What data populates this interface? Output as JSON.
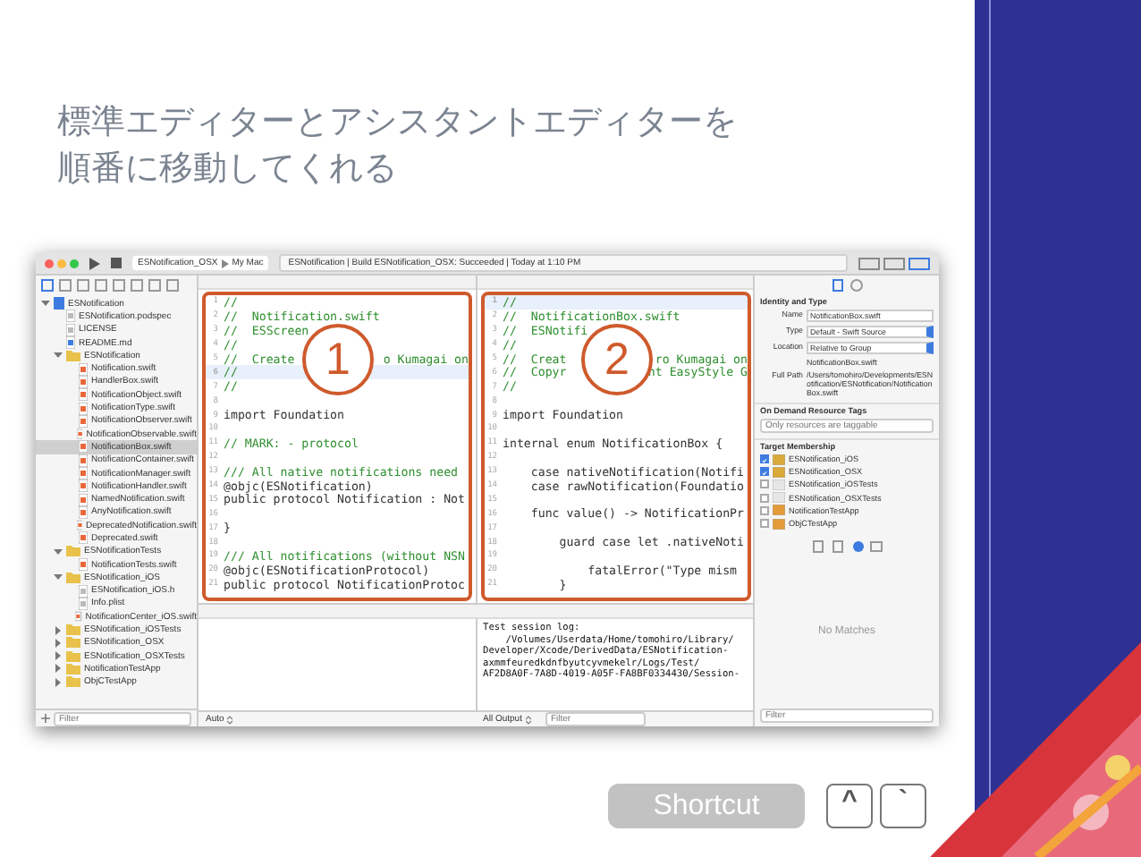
{
  "slide": {
    "title_lines": [
      "標準エディターとアシスタントエディターを",
      "順番に移動してくれる"
    ]
  },
  "xcode": {
    "toolbar": {
      "scheme": "ESNotification_OSX",
      "device": "My Mac",
      "status": "ESNotification  |  Build ESNotification_OSX: Succeeded  |  Today at 1:10 PM"
    },
    "navigator": {
      "items": [
        {
          "name": "ESNotification",
          "kind": "project",
          "expanded": true,
          "selected": false,
          "children": [
            {
              "name": "ESNotification.podspec",
              "kind": "file",
              "selected": false
            },
            {
              "name": "LICENSE",
              "kind": "file",
              "selected": false
            },
            {
              "name": "README.md",
              "kind": "doc",
              "selected": false
            },
            {
              "name": "ESNotification",
              "kind": "folder",
              "expanded": true,
              "selected": false,
              "children": [
                {
                  "name": "Notification.swift",
                  "kind": "swift",
                  "selected": false
                },
                {
                  "name": "HandlerBox.swift",
                  "kind": "swift",
                  "selected": false
                },
                {
                  "name": "NotificationObject.swift",
                  "kind": "swift",
                  "selected": false
                },
                {
                  "name": "NotificationType.swift",
                  "kind": "swift",
                  "selected": false
                },
                {
                  "name": "NotificationObserver.swift",
                  "kind": "swift",
                  "selected": false
                },
                {
                  "name": "NotificationObservable.swift",
                  "kind": "swift",
                  "selected": false
                },
                {
                  "name": "NotificationBox.swift",
                  "kind": "swift",
                  "selected": true
                },
                {
                  "name": "NotificationContainer.swift",
                  "kind": "swift",
                  "selected": false
                },
                {
                  "name": "NotificationManager.swift",
                  "kind": "swift",
                  "selected": false
                },
                {
                  "name": "NotificationHandler.swift",
                  "kind": "swift",
                  "selected": false
                },
                {
                  "name": "NamedNotification.swift",
                  "kind": "swift",
                  "selected": false
                },
                {
                  "name": "AnyNotification.swift",
                  "kind": "swift",
                  "selected": false
                },
                {
                  "name": "DeprecatedNotification.swift",
                  "kind": "swift",
                  "selected": false
                },
                {
                  "name": "Deprecated.swift",
                  "kind": "swift",
                  "selected": false
                }
              ]
            },
            {
              "name": "ESNotificationTests",
              "kind": "folder",
              "expanded": true,
              "selected": false,
              "children": [
                {
                  "name": "NotificationTests.swift",
                  "kind": "swift",
                  "selected": false
                }
              ]
            },
            {
              "name": "ESNotification_iOS",
              "kind": "folder",
              "expanded": true,
              "selected": false,
              "children": [
                {
                  "name": "ESNotification_iOS.h",
                  "kind": "file",
                  "selected": false
                },
                {
                  "name": "Info.plist",
                  "kind": "file",
                  "selected": false
                },
                {
                  "name": "NotificationCenter_iOS.swift",
                  "kind": "swift",
                  "selected": false
                }
              ]
            },
            {
              "name": "ESNotification_iOSTests",
              "kind": "folder",
              "expanded": false,
              "selected": false
            },
            {
              "name": "ESNotification_OSX",
              "kind": "folder",
              "expanded": false,
              "selected": false
            },
            {
              "name": "ESNotification_OSXTests",
              "kind": "folder",
              "expanded": false,
              "selected": false
            },
            {
              "name": "NotificationTestApp",
              "kind": "folder",
              "expanded": false,
              "selected": false
            },
            {
              "name": "ObjCTestApp",
              "kind": "folder",
              "expanded": false,
              "selected": false
            }
          ]
        }
      ],
      "filter_placeholder": "Filter"
    },
    "editors": [
      {
        "annotation": "1",
        "lines": [
          {
            "n": "1",
            "text": "//",
            "kind": "comment",
            "current": false
          },
          {
            "n": "2",
            "text": "//  Notification.swift",
            "kind": "comment",
            "current": false
          },
          {
            "n": "3",
            "text": "//  ESScreen",
            "kind": "comment",
            "current": false
          },
          {
            "n": "4",
            "text": "//",
            "kind": "comment",
            "current": false
          },
          {
            "n": "5",
            "text": "//  Create",
            "text_after": "o Kumagai on",
            "kind": "comment",
            "current": false
          },
          {
            "n": "6",
            "text": "//",
            "kind": "comment",
            "current": true
          },
          {
            "n": "7",
            "text": "//",
            "kind": "comment",
            "current": false
          },
          {
            "n": "8",
            "kind": "blank",
            "current": false
          },
          {
            "n": "9",
            "text": "import Foundation",
            "kind": "code",
            "current": false
          },
          {
            "n": "10",
            "kind": "blank",
            "current": false
          },
          {
            "n": "11",
            "text": "// MARK: - protocol",
            "kind": "comment",
            "current": false
          },
          {
            "n": "12",
            "kind": "blank",
            "current": false
          },
          {
            "n": "13",
            "text": "/// All native notifications need",
            "kind": "comment",
            "current": false
          },
          {
            "n": "14",
            "text": "@objc(ESNotification)",
            "kind": "code",
            "current": false
          },
          {
            "n": "15",
            "text": "public protocol Notification : Not",
            "kind": "code",
            "current": false
          },
          {
            "n": "16",
            "kind": "blank",
            "current": false
          },
          {
            "n": "17",
            "text": "}",
            "kind": "code",
            "current": false
          },
          {
            "n": "18",
            "kind": "blank",
            "current": false
          },
          {
            "n": "19",
            "text": "/// All notifications (without NSN",
            "kind": "comment",
            "current": false
          },
          {
            "n": "20",
            "text": "@objc(ESNotificationProtocol)",
            "kind": "code",
            "current": false
          },
          {
            "n": "21",
            "text": "public protocol NotificationProtoc",
            "kind": "code",
            "current": false
          }
        ]
      },
      {
        "annotation": "2",
        "lines": [
          {
            "n": "1",
            "text": "//",
            "kind": "comment",
            "current": true
          },
          {
            "n": "2",
            "text": "//  NotificationBox.swift",
            "kind": "comment",
            "current": false
          },
          {
            "n": "3",
            "text": "//  ESNotifi",
            "kind": "comment",
            "current": false
          },
          {
            "n": "4",
            "text": "//",
            "kind": "comment",
            "current": false
          },
          {
            "n": "5",
            "text": "//  Creat",
            "text_after": "ro Kumagai on",
            "kind": "comment",
            "current": false
          },
          {
            "n": "6",
            "text": "//  Copyr",
            "text_after": "ht EasyStyle G",
            "kind": "comment",
            "current": false
          },
          {
            "n": "7",
            "text": "//",
            "kind": "comment",
            "current": false
          },
          {
            "n": "8",
            "kind": "blank",
            "current": false
          },
          {
            "n": "9",
            "text": "import Foundation",
            "kind": "code",
            "current": false
          },
          {
            "n": "10",
            "kind": "blank",
            "current": false
          },
          {
            "n": "11",
            "text": "internal enum NotificationBox {",
            "kind": "code",
            "current": false
          },
          {
            "n": "12",
            "kind": "blank",
            "current": false
          },
          {
            "n": "13",
            "text": "    case nativeNotification(Notifi",
            "kind": "code",
            "current": false
          },
          {
            "n": "14",
            "text": "    case rawNotification(Foundatio",
            "kind": "code",
            "current": false
          },
          {
            "n": "15",
            "kind": "blank",
            "current": false
          },
          {
            "n": "16",
            "text": "    func value() -> NotificationPr",
            "kind": "code",
            "current": false
          },
          {
            "n": "17",
            "kind": "blank",
            "current": false
          },
          {
            "n": "18",
            "text": "        guard case let .nativeNoti",
            "kind": "code",
            "current": false
          },
          {
            "n": "19",
            "kind": "blank",
            "current": false
          },
          {
            "n": "20",
            "text": "            fatalError(\"Type mism",
            "kind": "code",
            "current": false
          },
          {
            "n": "21",
            "text": "        }",
            "kind": "code",
            "current": false
          }
        ]
      }
    ],
    "debug": {
      "variables_mode": "Auto",
      "console_mode": "All Output",
      "filter_placeholder": "Filter",
      "log": [
        "Test session log:",
        "    /Volumes/Userdata/Home/tomohiro/Library/",
        "Developer/Xcode/DerivedData/ESNotification-",
        "axmmfeuredkdnfbyutcyvmekelr/Logs/Test/",
        "AF2D8A0F-7A8D-4019-A05F-FA8BF0334430/Session-"
      ]
    },
    "inspector": {
      "section_identity": "Identity and Type",
      "fields": [
        {
          "label": "Name",
          "value": "NotificationBox.swift",
          "kind": "text"
        },
        {
          "label": "Type",
          "value": "Default - Swift Source",
          "kind": "popup"
        },
        {
          "label": "Location",
          "value": "Relative to Group",
          "kind": "popup"
        },
        {
          "value": "NotificationBox.swift",
          "kind": "plain"
        },
        {
          "label": "Full Path",
          "value": "/Users/tomohiro/Developments/ESNotification/ESNotification/NotificationBox.swift",
          "kind": "path"
        }
      ],
      "section_tags": "On Demand Resource Tags",
      "tags_placeholder": "Only resources are taggable",
      "section_targets": "Target Membership",
      "targets": [
        {
          "name": "ESNotification_iOS",
          "checked": true,
          "kind": "framework"
        },
        {
          "name": "ESNotification_OSX",
          "checked": true,
          "kind": "framework"
        },
        {
          "name": "ESNotification_iOSTests",
          "checked": false,
          "kind": "tests"
        },
        {
          "name": "ESNotification_OSXTests",
          "checked": false,
          "kind": "tests"
        },
        {
          "name": "NotificationTestApp",
          "checked": false,
          "kind": "app"
        },
        {
          "name": "ObjCTestApp",
          "checked": false,
          "kind": "app"
        }
      ],
      "library_empty": "No Matches",
      "filter_placeholder": "Filter"
    }
  },
  "shortcut": {
    "label": "Shortcut",
    "keys": [
      "^",
      "`"
    ]
  }
}
